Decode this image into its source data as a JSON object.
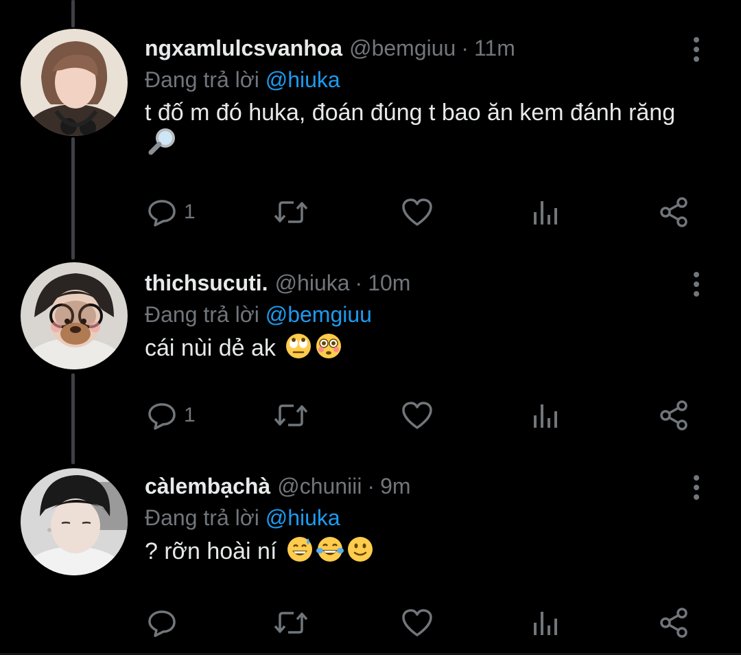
{
  "theme": {
    "background": "#000000",
    "text": "#e7e9ea",
    "muted": "#71767b",
    "accent": "#1d9bf0",
    "line": "#3e4144"
  },
  "tweets": [
    {
      "display_name": "ngxamlulcsvanhoa",
      "handle": "@bemgiuu",
      "time": "11m",
      "separator": "·",
      "replying_prefix": "Đang trả lời",
      "replying_to": "@hiuka",
      "text": "t đố m đó huka, đoán đúng t bao ăn kem đánh răng",
      "emojis": [
        "magnifying-glass"
      ],
      "reply_count": "1",
      "icons": [
        "reply-icon",
        "retweet-icon",
        "like-icon",
        "analytics-icon",
        "share-icon",
        "more-icon"
      ]
    },
    {
      "display_name": "thichsucuti.",
      "handle": "@hiuka",
      "time": "10m",
      "separator": "·",
      "replying_prefix": "Đang trả lời",
      "replying_to": "@bemgiuu",
      "text": "cái nùi dẻ ak",
      "emojis": [
        "rolling-eyes",
        "flushed-face"
      ],
      "reply_count": "1",
      "icons": [
        "reply-icon",
        "retweet-icon",
        "like-icon",
        "analytics-icon",
        "share-icon",
        "more-icon"
      ]
    },
    {
      "display_name": "càlembạchà",
      "handle": "@chuniii",
      "time": "9m",
      "separator": "·",
      "replying_prefix": "Đang trả lời",
      "replying_to": "@hiuka",
      "text": "? rỡn hoài ní",
      "emojis": [
        "grinning-sweat",
        "tears-of-joy",
        "slightly-smiling"
      ],
      "reply_count": "",
      "icons": [
        "reply-icon",
        "retweet-icon",
        "like-icon",
        "analytics-icon",
        "share-icon",
        "more-icon"
      ]
    }
  ]
}
